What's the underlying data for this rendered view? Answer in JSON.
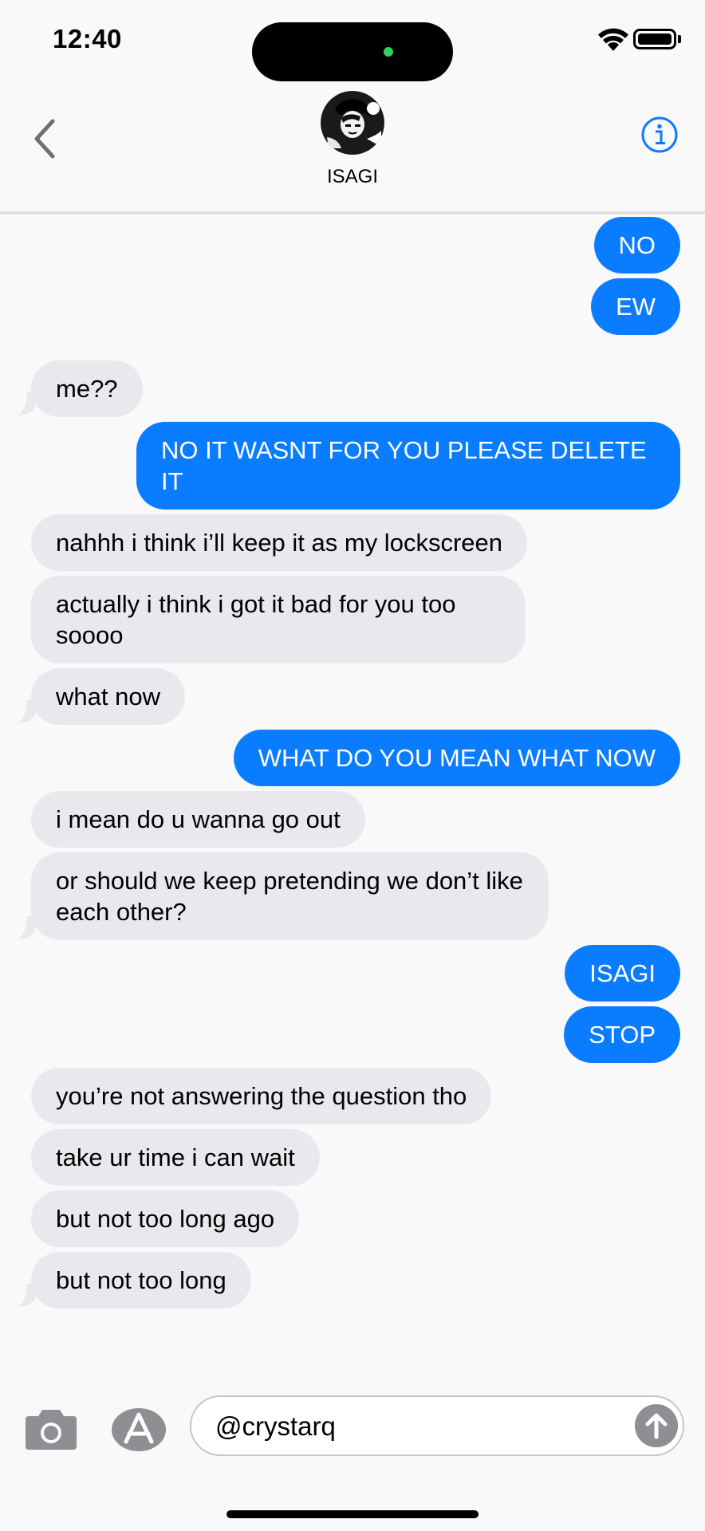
{
  "status_bar": {
    "time": "12:40"
  },
  "header": {
    "contact_name": "ISAGI"
  },
  "messages": [
    {
      "side": "out",
      "text": "NO"
    },
    {
      "side": "out",
      "text": "EW"
    },
    {
      "side": "in",
      "text": "me??"
    },
    {
      "side": "out",
      "text": "NO IT WASNT FOR YOU PLEASE DELETE IT"
    },
    {
      "side": "in",
      "text": "nahhh i think i’ll keep it as my lockscreen"
    },
    {
      "side": "in",
      "text": "actually i think i got it bad for you too soooo"
    },
    {
      "side": "in",
      "text": "what now"
    },
    {
      "side": "out",
      "text": "WHAT DO YOU MEAN WHAT NOW"
    },
    {
      "side": "in",
      "text": "i mean do u wanna go out"
    },
    {
      "side": "in",
      "text": "or should we keep pretending we don’t like each other?"
    },
    {
      "side": "out",
      "text": "ISAGI"
    },
    {
      "side": "out",
      "text": "STOP"
    },
    {
      "side": "in",
      "text": "you’re not answering the question tho"
    },
    {
      "side": "in",
      "text": "take ur time i can wait"
    },
    {
      "side": "in",
      "text": "but not too long ago"
    },
    {
      "side": "in",
      "text": "but not too long"
    }
  ],
  "composer": {
    "input_value": "@crystarq"
  },
  "colors": {
    "accent": "#0a7cff",
    "incoming_bubble": "#e9e8ed",
    "background": "#f9f9f9"
  },
  "icons": [
    "back-chevron-icon",
    "info-icon",
    "camera-icon",
    "app-store-icon",
    "send-arrow-icon"
  ]
}
